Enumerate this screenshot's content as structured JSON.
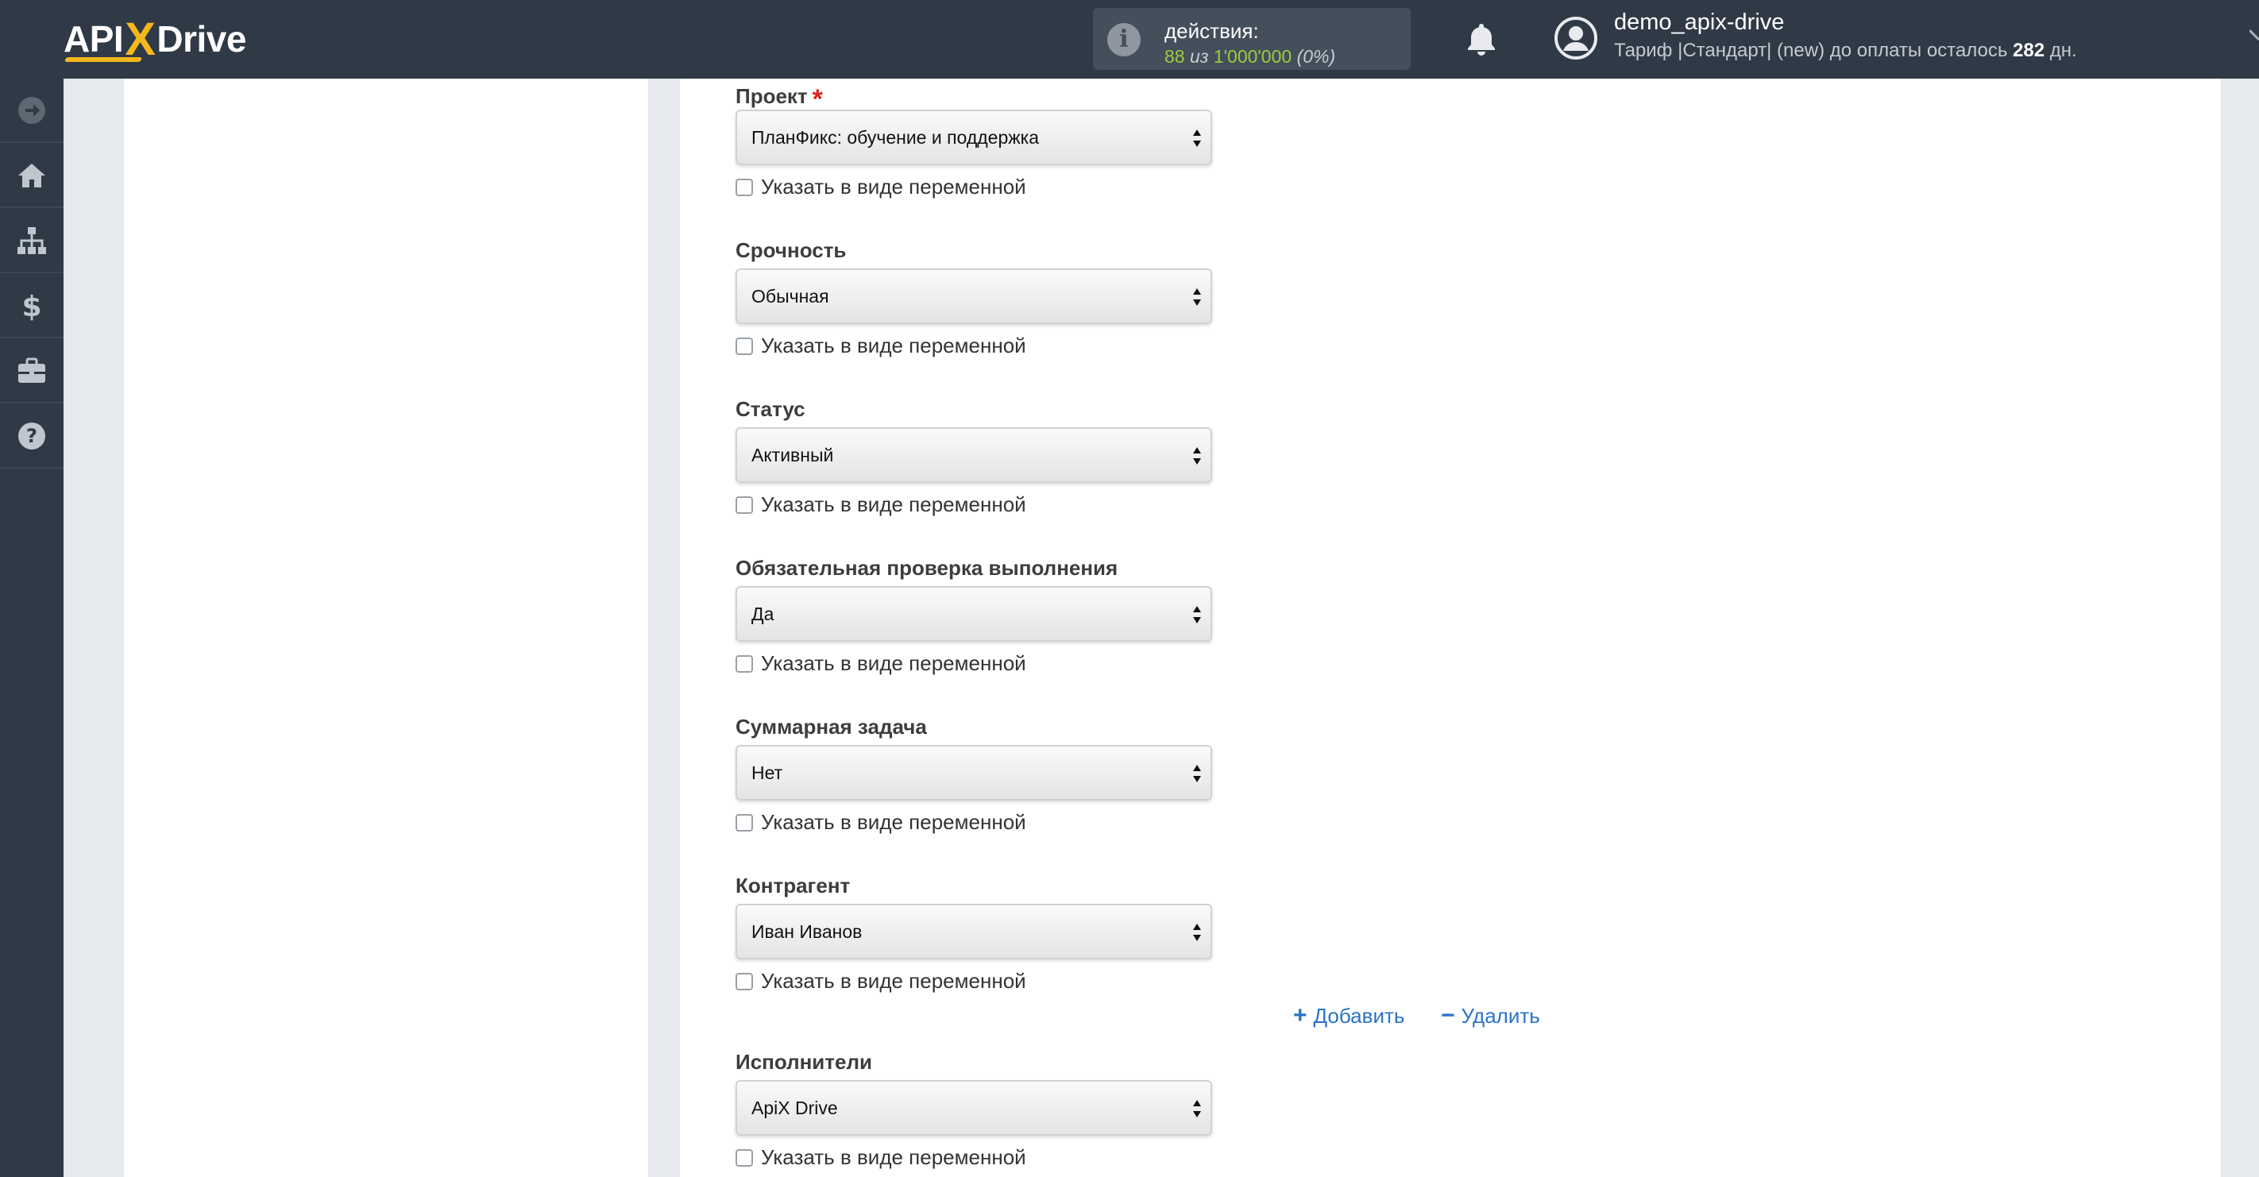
{
  "brand": {
    "logo_left": "API",
    "logo_x": "X",
    "logo_right": "Drive",
    "accent_color": "#f5b81c"
  },
  "header": {
    "actions_label": "действия:",
    "actions_used": "88",
    "actions_sep": "из",
    "actions_total": "1'000'000",
    "actions_percent": "(0%)",
    "username": "demo_apix-drive",
    "tariff_prefix": "Тариф |Стандарт| (new) до оплаты осталось",
    "tariff_days": "282",
    "tariff_suffix": "дн."
  },
  "sidebar": {
    "items": [
      {
        "icon": "arrow-right-circle-icon"
      },
      {
        "icon": "home-icon"
      },
      {
        "icon": "sitemap-icon"
      },
      {
        "icon": "dollar-icon"
      },
      {
        "icon": "briefcase-icon"
      },
      {
        "icon": "help-circle-icon"
      }
    ]
  },
  "form": {
    "var_label": "Указать в виде переменной",
    "fields": [
      {
        "label": "Проект",
        "required": "*",
        "value": "ПланФикс: обучение и поддержка"
      },
      {
        "label": "Срочность",
        "value": "Обычная"
      },
      {
        "label": "Статус",
        "value": "Активный"
      },
      {
        "label": "Обязательная проверка выполнения",
        "value": "Да"
      },
      {
        "label": "Суммарная задача",
        "value": "Нет"
      },
      {
        "label": "Контрагент",
        "value": "Иван Иванов"
      },
      {
        "label": "Исполнители",
        "value": "ApiX Drive"
      }
    ],
    "add_label": "Добавить",
    "remove_label": "Удалить",
    "add_symbol": "+",
    "remove_symbol": "−"
  }
}
